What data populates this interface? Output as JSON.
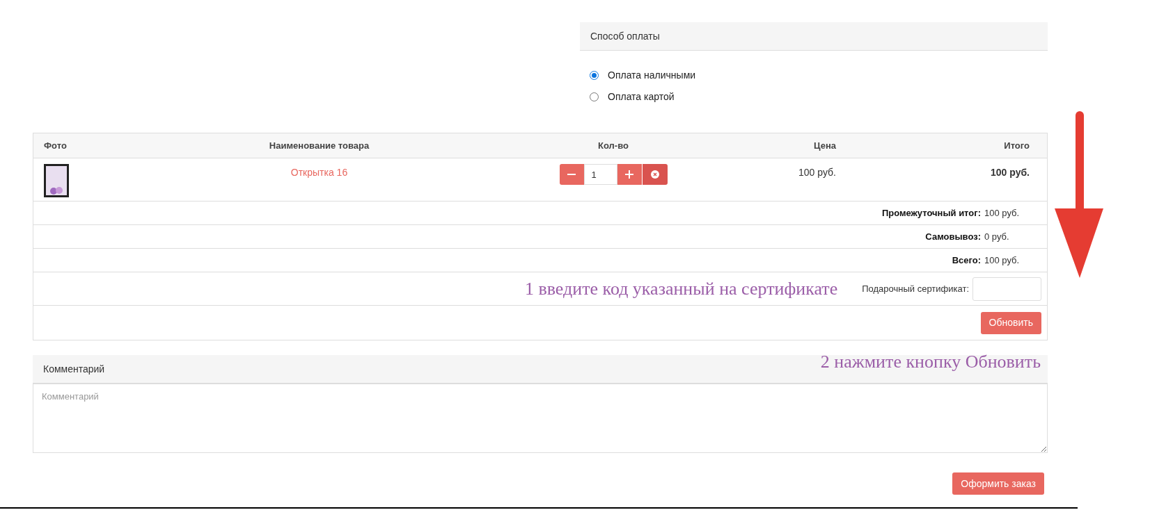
{
  "payment": {
    "title": "Способ оплаты",
    "options": [
      {
        "label": "Оплата наличными",
        "selected": true
      },
      {
        "label": "Оплата картой",
        "selected": false
      }
    ]
  },
  "cart": {
    "columns": [
      "Фото",
      "Наименование товара",
      "Кол-во",
      "Цена",
      "Итого"
    ],
    "rows": [
      {
        "name": "Открытка 16",
        "quantity": "1",
        "price": "100 руб.",
        "total": "100 руб."
      }
    ],
    "summary": [
      {
        "label": "Промежуточный итог:",
        "value": "100 руб."
      },
      {
        "label": "Самовывоз:",
        "value": "0 руб."
      },
      {
        "label": "Всего:",
        "value": "100 руб."
      }
    ],
    "certificate": {
      "label": "Подарочный сертификат:"
    },
    "update_button": "Обновить"
  },
  "annotations": [
    "1 введите код указанный на сертификате",
    "2 нажмите кнопку Обновить"
  ],
  "comment": {
    "title": "Комментарий",
    "placeholder": "Комментарий"
  },
  "submit_button": "Оформить заказ"
}
